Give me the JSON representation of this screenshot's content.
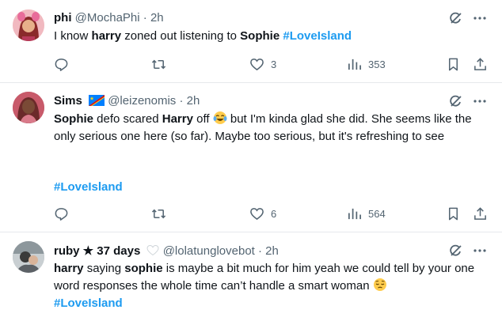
{
  "tweets": [
    {
      "name": "phi",
      "handle": "@MochaPhi",
      "sep": "·",
      "time": "2h",
      "text_1": "I know ",
      "bold_1": "harry",
      "text_2": " zoned out listening to ",
      "bold_2": "Sophie",
      "text_3": " ",
      "hashtag": "#LoveIsland",
      "replies": "",
      "retweets": "",
      "likes": "3",
      "views": "353"
    },
    {
      "name": "Sims",
      "handle": "@leizenomis",
      "sep": "·",
      "time": "2h",
      "bold_1": "Sophie",
      "text_1": " defo scared ",
      "bold_2": "Harry",
      "text_2": " off ",
      "text_3": " but I'm kinda glad she did. She seems like the only serious one here (so far). Maybe too serious, but it's refreshing to see",
      "hashtag": "#LoveIsland",
      "likes": "6",
      "views": "564"
    },
    {
      "name": "ruby ★ 37 days",
      "handle": "@lolatunglovebot",
      "sep": "·",
      "time": "2h",
      "bold_1": "harry",
      "text_1": " saying ",
      "bold_2": "sophie",
      "text_2": " is maybe a bit much for him yeah we could tell by your one word responses the whole time can’t handle a smart woman ",
      "hashtag": "#LoveIsland"
    }
  ],
  "icons": {
    "reply": "reply-icon",
    "retweet": "retweet-icon",
    "like": "like-icon",
    "views": "views-icon",
    "bookmark": "bookmark-icon",
    "share": "share-icon",
    "grok": "grok-icon",
    "more": "more-icon"
  },
  "colors": {
    "hashtag": "#1d9bf0",
    "muted": "#536471",
    "text": "#0f1419",
    "divider": "#e6e9ec"
  }
}
